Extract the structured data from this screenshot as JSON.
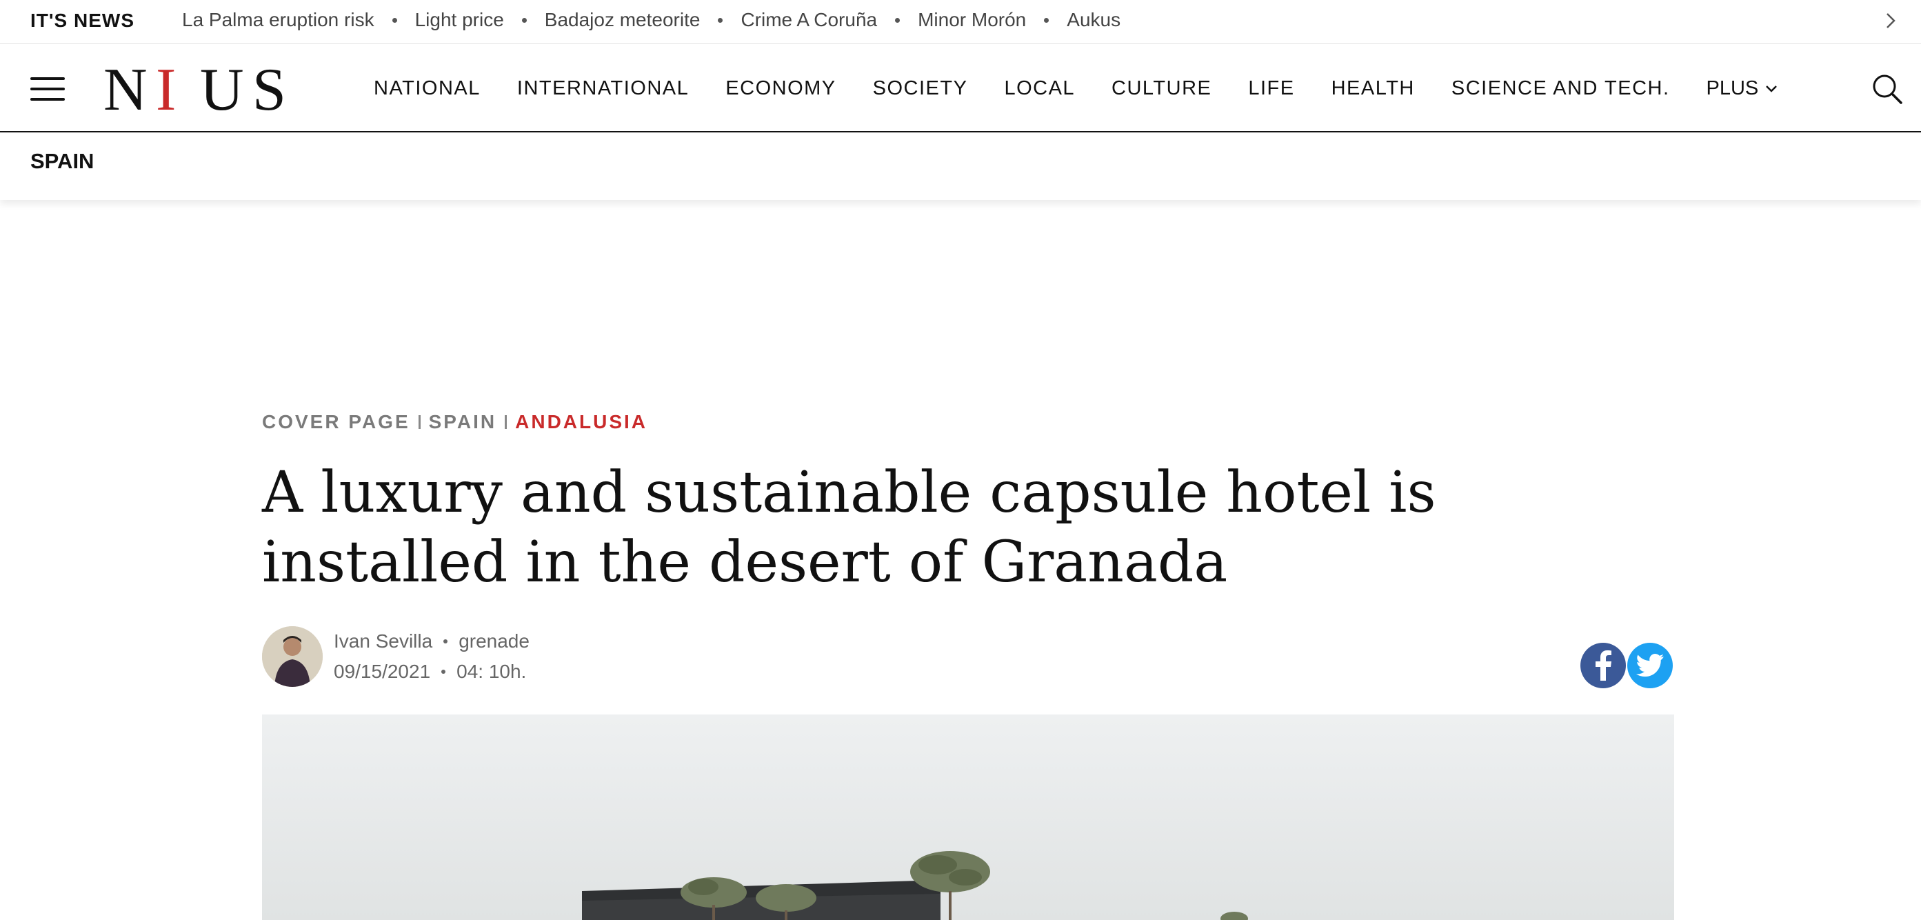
{
  "newsbar": {
    "label": "IT'S NEWS",
    "items": [
      "La Palma eruption risk",
      "Light price",
      "Badajoz meteorite",
      "Crime A Coruña",
      "Minor Morón",
      "Aukus"
    ],
    "next_icon": "chevron-right-icon"
  },
  "header": {
    "menu_icon": "hamburger-menu-icon",
    "logo": {
      "letters": [
        "N",
        "I",
        "U",
        "S"
      ],
      "accent": "#c92a2a"
    },
    "nav": [
      "NATIONAL",
      "INTERNATIONAL",
      "ECONOMY",
      "SOCIETY",
      "LOCAL",
      "CULTURE",
      "LIFE",
      "HEALTH",
      "SCIENCE AND TECH."
    ],
    "more_label": "PLUS",
    "search_icon": "search-icon"
  },
  "section": {
    "title": "SPAIN"
  },
  "article": {
    "breadcrumb": [
      "COVER PAGE",
      "SPAIN",
      "ANDALUSIA"
    ],
    "headline": "A luxury and sustainable capsule hotel is installed in the desert of Granada",
    "author": "Ivan Sevilla",
    "location": "grenade",
    "date": "09/15/2021",
    "time": "04: 10h."
  },
  "share": {
    "facebook_icon": "facebook-icon",
    "twitter_icon": "twitter-icon",
    "facebook_color": "#3b5998",
    "twitter_color": "#1da1f2"
  }
}
